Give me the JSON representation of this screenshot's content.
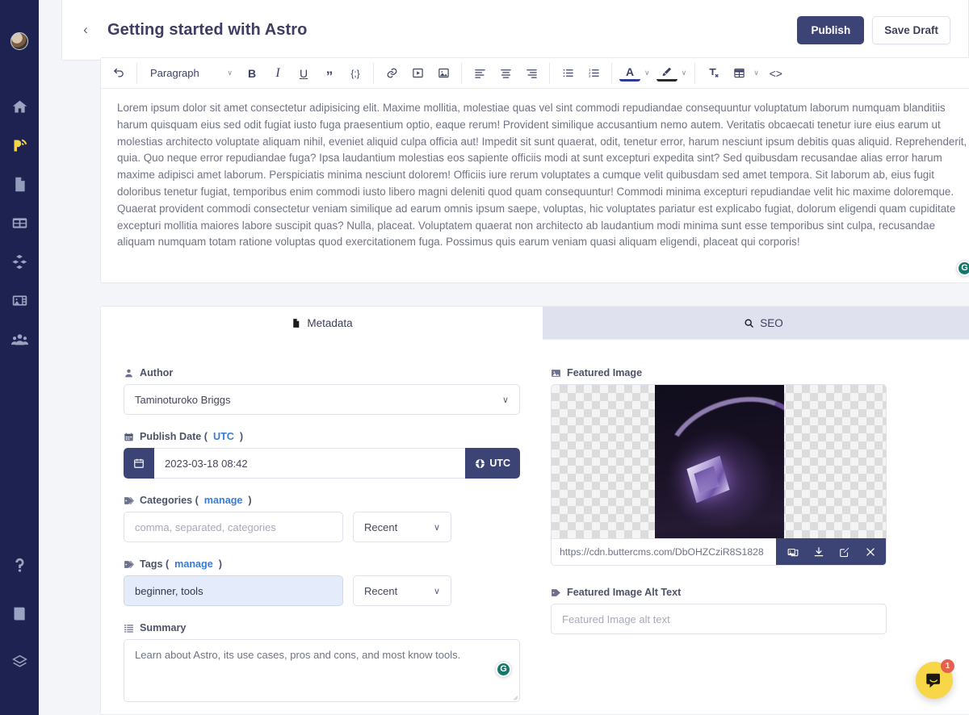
{
  "sidebar": {
    "avatar_name": "user-avatar",
    "items": [
      {
        "icon": "home-icon",
        "name": "sidebar-item-home"
      },
      {
        "icon": "blog-icon",
        "name": "sidebar-item-blog"
      },
      {
        "icon": "pages-icon",
        "name": "sidebar-item-pages"
      },
      {
        "icon": "collections-icon",
        "name": "sidebar-item-collections"
      },
      {
        "icon": "components-icon",
        "name": "sidebar-item-components"
      },
      {
        "icon": "media-icon",
        "name": "sidebar-item-media"
      },
      {
        "icon": "team-icon",
        "name": "sidebar-item-team"
      }
    ],
    "bottom_items": [
      {
        "icon": "help-icon",
        "name": "sidebar-item-help"
      },
      {
        "icon": "book-icon",
        "name": "sidebar-item-docs"
      },
      {
        "icon": "layers-icon",
        "name": "sidebar-item-layers"
      }
    ]
  },
  "header": {
    "back_label": "‹",
    "title": "Getting started with Astro",
    "publish_label": "Publish",
    "save_draft_label": "Save Draft"
  },
  "toolbar": {
    "undo_label": "undo-icon",
    "block_format": "Paragraph",
    "caret": "∨",
    "bold_label": "B",
    "italic_label": "I",
    "underline_label": "U",
    "quote_label": "”",
    "code_inline_label": "{;}",
    "link_label": "link-icon",
    "video_label": "video-icon",
    "image_label": "image-icon",
    "align_left_label": "align-left-icon",
    "align_center_label": "align-center-icon",
    "align_right_label": "align-right-icon",
    "bullet_list_label": "bullet-list-icon",
    "number_list_label": "number-list-icon",
    "font_color_label": "A",
    "highlight_label": "highlight-icon",
    "clear_format_label": "clear-format-icon",
    "table_label": "table-icon",
    "source_label": "<>"
  },
  "editor": {
    "body": "Lorem ipsum dolor sit amet consectetur adipisicing elit. Maxime mollitia, molestiae quas vel sint commodi repudiandae consequuntur voluptatum laborum numquam blanditiis harum quisquam eius sed odit fugiat iusto fuga praesentium optio, eaque rerum! Provident similique accusantium nemo autem. Veritatis obcaecati tenetur iure eius earum ut molestias architecto voluptate aliquam nihil, eveniet aliquid culpa officia aut! Impedit sit sunt quaerat, odit, tenetur error, harum nesciunt ipsum debitis quas aliquid. Reprehenderit, quia. Quo neque error repudiandae fuga? Ipsa laudantium molestias eos sapiente officiis modi at sunt excepturi expedita sint? Sed quibusdam recusandae alias error harum maxime adipisci amet laborum. Perspiciatis minima nesciunt dolorem! Officiis iure rerum voluptates a cumque velit quibusdam sed amet tempora. Sit laborum ab, eius fugit doloribus tenetur fugiat, temporibus enim commodi iusto libero magni deleniti quod quam consequuntur! Commodi minima excepturi repudiandae velit hic maxime doloremque. Quaerat provident commodi consectetur veniam similique ad earum omnis ipsum saepe, voluptas, hic voluptates pariatur est explicabo fugiat, dolorum eligendi quam cupiditate excepturi mollitia maiores labore suscipit quas? Nulla, placeat. Voluptatem quaerat non architecto ab laudantium modi minima sunt esse temporibus sint culpa, recusandae aliquam numquam totam ratione voluptas quod exercitationem fuga. Possimus quis earum veniam quasi aliquam eligendi, placeat qui corporis!",
    "grammarly_label": "G"
  },
  "tabs": [
    {
      "label": "Metadata",
      "icon": "document-icon",
      "active": true
    },
    {
      "label": "SEO",
      "icon": "search-icon",
      "active": false
    }
  ],
  "metadata": {
    "author": {
      "label": "Author",
      "icon": "person-icon",
      "value": "Taminoturoko Briggs"
    },
    "publish_date": {
      "label": "Publish Date (",
      "label_link": "UTC",
      "label_tail": ")",
      "icon": "calendar-icon",
      "value": "2023-03-18 08:42",
      "timezone_button": "UTC"
    },
    "categories": {
      "label": "Categories (",
      "label_link": "manage",
      "label_tail": ")",
      "icon": "tag-icon",
      "placeholder": "comma, separated, categories",
      "value": "",
      "recent_label": "Recent"
    },
    "tags": {
      "label": "Tags (",
      "label_link": "manage",
      "label_tail": ")",
      "icon": "tag-icon",
      "value": "beginner, tools",
      "recent_label": "Recent"
    },
    "summary": {
      "label": "Summary",
      "icon": "list-icon",
      "value": "Learn about Astro, its use cases, pros and cons, and most know tools.",
      "grammarly_label": "G"
    }
  },
  "seo": {
    "featured_image": {
      "label": "Featured Image",
      "icon": "image-icon",
      "url": "https://cdn.buttercms.com/DbOHZCziR8S1828",
      "actions": [
        {
          "name": "replace-image-button",
          "icon": "images-icon"
        },
        {
          "name": "download-image-button",
          "icon": "download-icon"
        },
        {
          "name": "edit-image-button",
          "icon": "pencil-square-icon"
        },
        {
          "name": "remove-image-button",
          "icon": "close-icon"
        }
      ]
    },
    "alt_text": {
      "label": "Featured Image Alt Text",
      "icon": "tag-icon",
      "placeholder": "Featured Image alt text",
      "value": ""
    }
  },
  "intercom": {
    "badge_count": "1",
    "icon": "chat-bubble-icon"
  },
  "colors": {
    "sidebar_bg": "#1e2250",
    "accent_navy": "#3c4475",
    "link_blue": "#3a7bd5",
    "tag_field_bg": "#e4ecfb",
    "intercom_yellow": "#f7d648",
    "badge_red": "#e8604c",
    "grammarly_green": "#15776a"
  }
}
